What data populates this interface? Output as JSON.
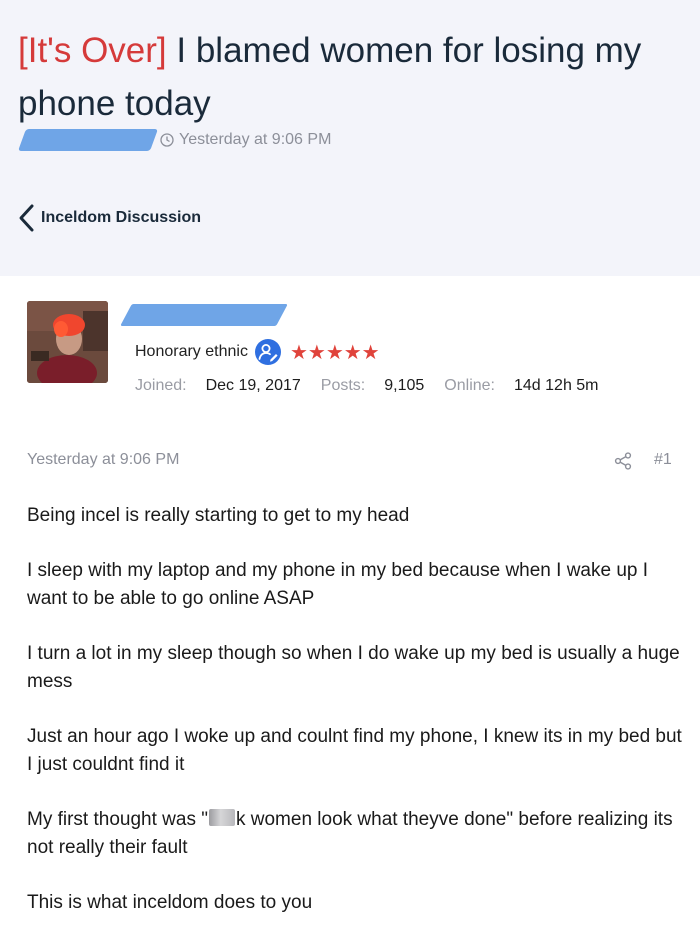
{
  "thread": {
    "prefix": "[It's Over]",
    "title": "I blamed women for losing my phone today",
    "timestamp": "Yesterday at 9:06 PM"
  },
  "nav": {
    "back_label": "Inceldom Discussion"
  },
  "user": {
    "title": "Honorary ethnic",
    "star_count": 5,
    "stats": [
      {
        "label": "Joined:",
        "value": "Dec 19, 2017"
      },
      {
        "label": "Posts:",
        "value": "9,105"
      },
      {
        "label": "Online:",
        "value": "14d 12h 5m"
      }
    ]
  },
  "post": {
    "date": "Yesterday at 9:06 PM",
    "number": "#1",
    "paragraphs": [
      "Being incel is really starting to get to my head",
      "I sleep with my laptop and my phone in my bed because when I wake up I want to be able to go online ASAP",
      "I turn a lot in my sleep though so when I do wake up my bed is usually a huge mess",
      "Just an hour ago I woke up and coulnt find my phone, I knew its in my bed but I just couldnt find it",
      {
        "before": "My first thought was \"",
        "after": "k women look what theyve done\" before realizing its not really their fault"
      },
      "This is what inceldom does to you"
    ]
  },
  "colors": {
    "prefix_red": "#d53a3a",
    "redaction_blue": "#6fa5e7",
    "star_red": "#e0433b",
    "header_bg": "#f3f4fa"
  },
  "icons": {
    "meta": "clock-icon",
    "back": "chevron-left-icon",
    "badge": "user-edit-icon",
    "share": "share-icon"
  }
}
